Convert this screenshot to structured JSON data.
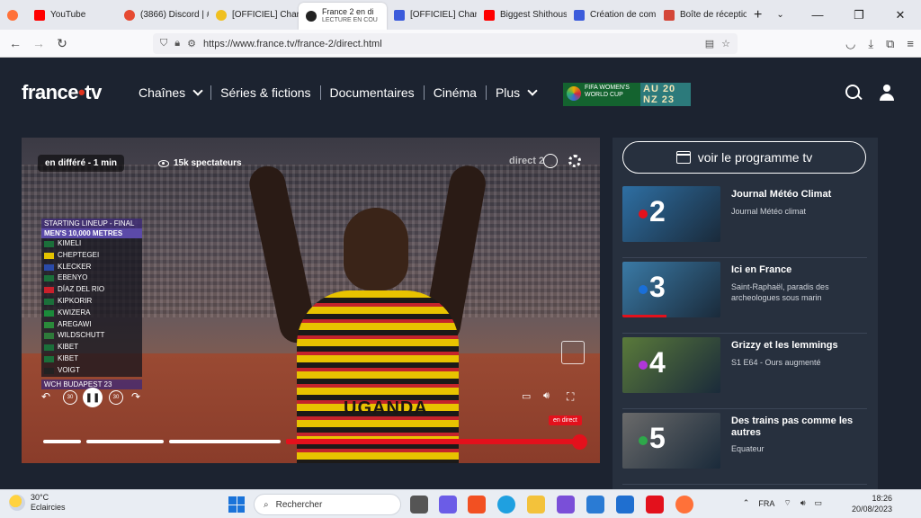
{
  "browser": {
    "tabs": [
      {
        "label": "YouTube",
        "color": "#ff0000"
      },
      {
        "label": "(3866) Discord | #",
        "color": "#e64a32"
      },
      {
        "label": "[OFFICIEL] Cham",
        "color": "#f0c020"
      },
      {
        "label": "France 2 en di",
        "sublabel": "LECTURE EN COU",
        "color": "#222222",
        "active": true
      },
      {
        "label": "[OFFICIEL] Cham",
        "color": "#3b5bdb"
      },
      {
        "label": "Biggest Shithous",
        "color": "#ff0000"
      },
      {
        "label": "Création de com",
        "color": "#3b5bdb"
      },
      {
        "label": "Boîte de réceptio",
        "color": "#d44638"
      }
    ],
    "new_tab": "+",
    "url": "https://www.france.tv/france-2/direct.html"
  },
  "site": {
    "logo_main": "france",
    "logo_dot": "•",
    "logo_tail": "tv",
    "nav": [
      "Chaînes",
      "Séries & fictions",
      "Documentaires",
      "Cinéma",
      "Plus"
    ],
    "fifa_left": "FIFA WOMEN'S WORLD CUP",
    "fifa_right": "AU 20 NZ 23"
  },
  "player": {
    "badge": "en différé - 1 min",
    "viewers": "15k spectateurs",
    "channel_mark": "direct 2",
    "lineup_header": "STARTING LINEUP - FINAL",
    "lineup_event": "MEN'S 10,000 METRES",
    "lineup": [
      {
        "name": "KIMELI",
        "flag": "#1b6f3a"
      },
      {
        "name": "CHEPTEGEI",
        "flag": "#e3c200"
      },
      {
        "name": "KLECKER",
        "flag": "#2a4aa8"
      },
      {
        "name": "EBENYO",
        "flag": "#1b6f3a"
      },
      {
        "name": "DÍAZ DEL RIO",
        "flag": "#c8202b"
      },
      {
        "name": "KIPKORIR",
        "flag": "#1b6f3a"
      },
      {
        "name": "KWIZERA",
        "flag": "#1b8a3a"
      },
      {
        "name": "AREGAWI",
        "flag": "#2a8a3a"
      },
      {
        "name": "WILDSCHUTT",
        "flag": "#2e7a3a"
      },
      {
        "name": "KIBET",
        "flag": "#1b6f3a"
      },
      {
        "name": "KIBET",
        "flag": "#1b6f3a"
      },
      {
        "name": "VOIGT",
        "flag": "#222222"
      }
    ],
    "lineup_footer": "WCH BUDAPEST 23",
    "jersey_text": "UGANDA",
    "controls": {
      "back": "↶",
      "rewind": "30",
      "pause": "❚❚",
      "forward": "30",
      "reload": "↷"
    },
    "live_tag": "en direct"
  },
  "sidebar": {
    "program_button": "voir le programme tv",
    "cards": [
      {
        "title": "Journal Météo Climat",
        "subtitle": "Journal Météo climat",
        "number": "2",
        "dot": "#e3111c",
        "bg": "#2e6fa3",
        "progress": 0
      },
      {
        "title": "Ici en France",
        "subtitle": "Saint-Raphaël, paradis des archeologues sous marin",
        "number": "3",
        "dot": "#1a6fd8",
        "bg": "#3a7aa6",
        "progress": 0.45
      },
      {
        "title": "Grizzy et les lemmings",
        "subtitle": "S1 E64 - Ours augmenté",
        "number": "4",
        "dot": "#b036d8",
        "bg": "#5a7a3a",
        "progress": 0
      },
      {
        "title": "Des trains pas comme les autres",
        "subtitle": "Equateur",
        "number": "5",
        "dot": "#2ea84a",
        "bg": "#6a6a6a",
        "progress": 0
      }
    ]
  },
  "taskbar": {
    "temp": "30°C",
    "weather": "Eclaircies",
    "search": "Rechercher",
    "lang": "FRA",
    "time": "18:26",
    "date": "20/08/2023"
  }
}
